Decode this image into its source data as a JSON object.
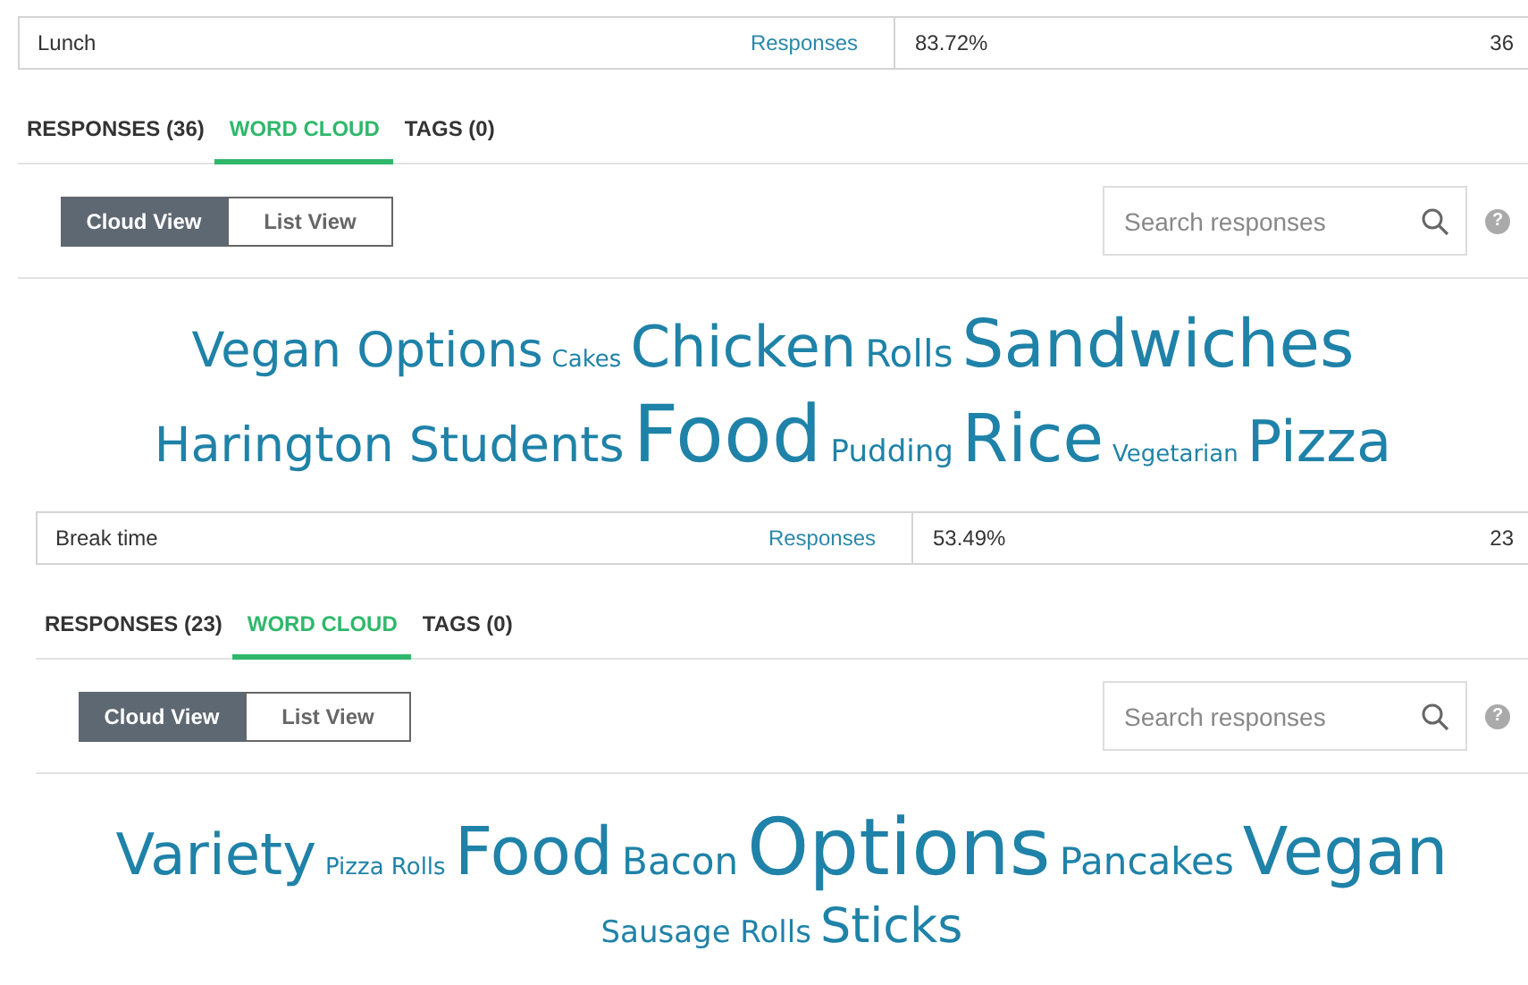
{
  "questions": [
    {
      "answer": "Lunch",
      "link": "Responses",
      "percent": "83.72%",
      "count": "36",
      "tabs": [
        {
          "label": "RESPONSES (36)",
          "selected": false
        },
        {
          "label": "WORD CLOUD",
          "selected": true
        },
        {
          "label": "TAGS (0)",
          "selected": false
        }
      ],
      "views": [
        {
          "label": "Cloud View",
          "selected": true
        },
        {
          "label": "List View",
          "selected": false
        }
      ],
      "search": {
        "placeholder": "Search responses"
      },
      "help": "?",
      "cloud": [
        [
          {
            "word": "Vegan Options",
            "kind": "medium"
          },
          {
            "word": "Cakes",
            "kind": "tiny"
          },
          {
            "word": "Chicken",
            "kind": "large"
          },
          {
            "word": "Rolls",
            "kind": "small"
          },
          {
            "word": "Sandwiches",
            "kind": "big"
          }
        ],
        [
          {
            "word": "Harington Students",
            "kind": "medium"
          },
          {
            "word": "Food",
            "kind": "huge"
          },
          {
            "word": "Pudding",
            "kind": "little"
          },
          {
            "word": "Rice",
            "kind": "big"
          },
          {
            "word": "Vegetarian",
            "kind": "tiny"
          },
          {
            "word": "Pizza",
            "kind": "large"
          }
        ]
      ]
    },
    {
      "answer": "Break time",
      "link": "Responses",
      "percent": "53.49%",
      "count": "23",
      "tabs": [
        {
          "label": "RESPONSES (23)",
          "selected": false
        },
        {
          "label": "WORD CLOUD",
          "selected": true
        },
        {
          "label": "TAGS (0)",
          "selected": false
        }
      ],
      "views": [
        {
          "label": "Cloud View",
          "selected": true
        },
        {
          "label": "List View",
          "selected": false
        }
      ],
      "search": {
        "placeholder": "Search responses"
      },
      "help": "?",
      "cloud": [
        [
          {
            "word": "Variety",
            "kind": "large"
          },
          {
            "word": "Pizza Rolls",
            "kind": "tiny"
          },
          {
            "word": "Food",
            "kind": "big"
          },
          {
            "word": "Bacon",
            "kind": "small"
          },
          {
            "word": "Options",
            "kind": "huge"
          },
          {
            "word": "Pancakes",
            "kind": "small"
          },
          {
            "word": "Vegan",
            "kind": "big"
          }
        ],
        [
          {
            "word": "Sausage Rolls",
            "kind": "little"
          },
          {
            "word": "Sticks",
            "kind": "medium"
          }
        ]
      ]
    }
  ]
}
